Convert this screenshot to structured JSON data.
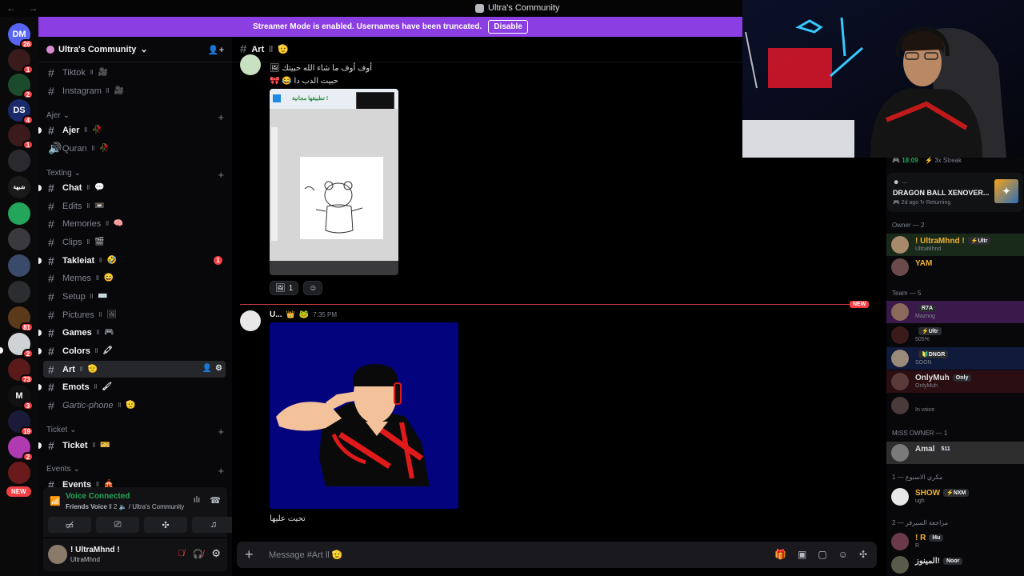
{
  "window": {
    "title": "Ultra's Community",
    "back": "←",
    "forward": "→"
  },
  "banner": {
    "text": "Streamer Mode is enabled. Usernames have been truncated.",
    "button": "Disable"
  },
  "server": {
    "name": "Ultra's Community"
  },
  "rail": {
    "new_label": "NEW",
    "servers": [
      {
        "label": "DM",
        "badge": "26",
        "color": "#5865f2"
      },
      {
        "label": "",
        "badge": "1",
        "color": "#3a1a1a"
      },
      {
        "label": "",
        "badge": "2",
        "color": "#1b4a2c"
      },
      {
        "label": "DS",
        "badge": "4",
        "color": "#1a2a6a"
      },
      {
        "label": "",
        "badge": "1",
        "color": "#3a1a1a"
      },
      {
        "label": "",
        "badge": "",
        "color": "#2a2a2e"
      },
      {
        "label": "شبهة",
        "badge": "",
        "color": "#1a1a1a"
      },
      {
        "label": "",
        "badge": "",
        "color": "#23a55a"
      },
      {
        "label": "",
        "badge": "",
        "color": "#3a3a3e"
      },
      {
        "label": "",
        "badge": "",
        "color": "#3a4a6a"
      },
      {
        "label": "",
        "badge": "",
        "color": "#2b2d31"
      },
      {
        "label": "",
        "badge": "81",
        "color": "#5a3a1a"
      },
      {
        "label": "",
        "badge": "2",
        "color": "#cfd3d6"
      },
      {
        "label": "",
        "badge": "73",
        "color": "#5a1a1a"
      },
      {
        "label": "M",
        "badge": "3",
        "color": "#111"
      },
      {
        "label": "",
        "badge": "19",
        "color": "#1a1a3a"
      },
      {
        "label": "",
        "badge": "2",
        "color": "#b03ab0"
      },
      {
        "label": "",
        "badge": "",
        "color": "#6a1a1a"
      }
    ]
  },
  "sidebar": {
    "channels_top": [
      {
        "name": "Tiktok",
        "sep": "ll",
        "emoji": "🎥"
      },
      {
        "name": "Instagram",
        "sep": "ll",
        "emoji": "🎥"
      }
    ],
    "categories": [
      {
        "name": "Ajer",
        "plus": "+"
      },
      {
        "name": "Texting",
        "plus": "+"
      },
      {
        "name": "Ticket",
        "plus": "+"
      },
      {
        "name": "Events",
        "plus": "+"
      }
    ],
    "ajer": [
      {
        "name": "Ajer",
        "sep": "ll",
        "emoji": "🥀",
        "icon": "#"
      },
      {
        "name": "Quran",
        "sep": "ll",
        "emoji": "🥀",
        "icon": "🔊"
      }
    ],
    "texting": [
      {
        "name": "Chat",
        "sep": "ll",
        "emoji": "💬"
      },
      {
        "name": "Edits",
        "sep": "ll",
        "emoji": "📼"
      },
      {
        "name": "Memories",
        "sep": "ll",
        "emoji": "🧠"
      },
      {
        "name": "Clips",
        "sep": "ll",
        "emoji": "🎬"
      },
      {
        "name": "Takleiat",
        "sep": "ll",
        "emoji": "🤣",
        "mention": "1"
      },
      {
        "name": "Memes",
        "sep": "ll",
        "emoji": "😄"
      },
      {
        "name": "Setup",
        "sep": "ll",
        "emoji": "⌨️"
      },
      {
        "name": "Pictures",
        "sep": "ll",
        "emoji": "🖼"
      },
      {
        "name": "Games",
        "sep": "ll",
        "emoji": "🎮"
      },
      {
        "name": "Colors",
        "sep": "ll",
        "emoji": "🖍"
      },
      {
        "name": "Art",
        "sep": "ll",
        "emoji": "🫡"
      },
      {
        "name": "Emots",
        "sep": "ll",
        "emoji": "🖌"
      },
      {
        "name": "Gartic-phone",
        "sep": "ll",
        "emoji": "🫡"
      }
    ],
    "ticket": [
      {
        "name": "Ticket",
        "sep": "ll",
        "emoji": "🎫"
      }
    ],
    "events": [
      {
        "name": "Events",
        "sep": "ll",
        "emoji": "🎪"
      }
    ]
  },
  "voice": {
    "status": "Voice Connected",
    "channel": "Friends Voice",
    "count": "ll 2",
    "server": "/ Ultra's Community"
  },
  "user": {
    "name": "! UltraMhnd !",
    "status": "UltraMhnd"
  },
  "chat": {
    "channel": "Art",
    "sep": "ll",
    "emoji": "🫡",
    "line1": "أوف أوف ما شاء الله حبيتك",
    "line2": "حبيت الدب دا",
    "img1_title": "تطبيقها مجانية !",
    "reaction_count": "1",
    "new_label": "NEW",
    "msg2_user": "U...",
    "msg2_time": "7:35 PM",
    "caption": "تحيت عليها",
    "composer_placeholder": "Message #Art ll 🫡"
  },
  "members": {
    "activity_time": "18:09",
    "activity_streak": "3x Streak",
    "game_title": "DRAGON BALL XENOVER...",
    "game_dots": "...",
    "game_ago": "2d ago",
    "game_returning": "Returning",
    "sections": [
      {
        "label": "Owner — 2"
      },
      {
        "label": "Team — 5"
      },
      {
        "label": "MISS OWNER — 1"
      },
      {
        "label": "مكري الاسبوع — 1"
      },
      {
        "label": "مراجعة السيرفر — 2"
      }
    ],
    "list": [
      {
        "name": "! UltraMhnd !",
        "tag": "⚡Ultr",
        "sub": "UltraMhnd",
        "color": "#f0b232",
        "section": 0
      },
      {
        "name": "YAM",
        "tag": "",
        "sub": "",
        "color": "#f0b232",
        "section": 0
      },
      {
        "name": "",
        "tag": "R7A",
        "sub": "Maznog",
        "color": "#c9a2f0",
        "section": 1
      },
      {
        "name": "",
        "tag": "⚡Ultr",
        "sub": "505%",
        "color": "#dbdee1",
        "section": 1
      },
      {
        "name": "",
        "tag": "🔰DNGR",
        "sub": "SOON",
        "color": "#dbdee1",
        "section": 1
      },
      {
        "name": "OnlyMuh",
        "tag": "Only",
        "sub": "OnlyMuh",
        "color": "#dbdee1",
        "section": 1
      },
      {
        "name": "",
        "tag": "",
        "sub": "In voice",
        "color": "#dbdee1",
        "section": 1
      },
      {
        "name": "Amal",
        "tag": "511",
        "sub": "",
        "color": "#dbdee1",
        "section": 2
      },
      {
        "name": "SHOW",
        "tag": "⚡NXM",
        "sub": "ugh",
        "color": "#f0b232",
        "section": 3
      },
      {
        "name": "! R",
        "tag": "l4u",
        "sub": "R",
        "color": "#f0b232",
        "section": 4
      },
      {
        "name": "المينوز!",
        "tag": "Noor",
        "sub": "",
        "color": "#dbdee1",
        "section": 4
      }
    ]
  }
}
